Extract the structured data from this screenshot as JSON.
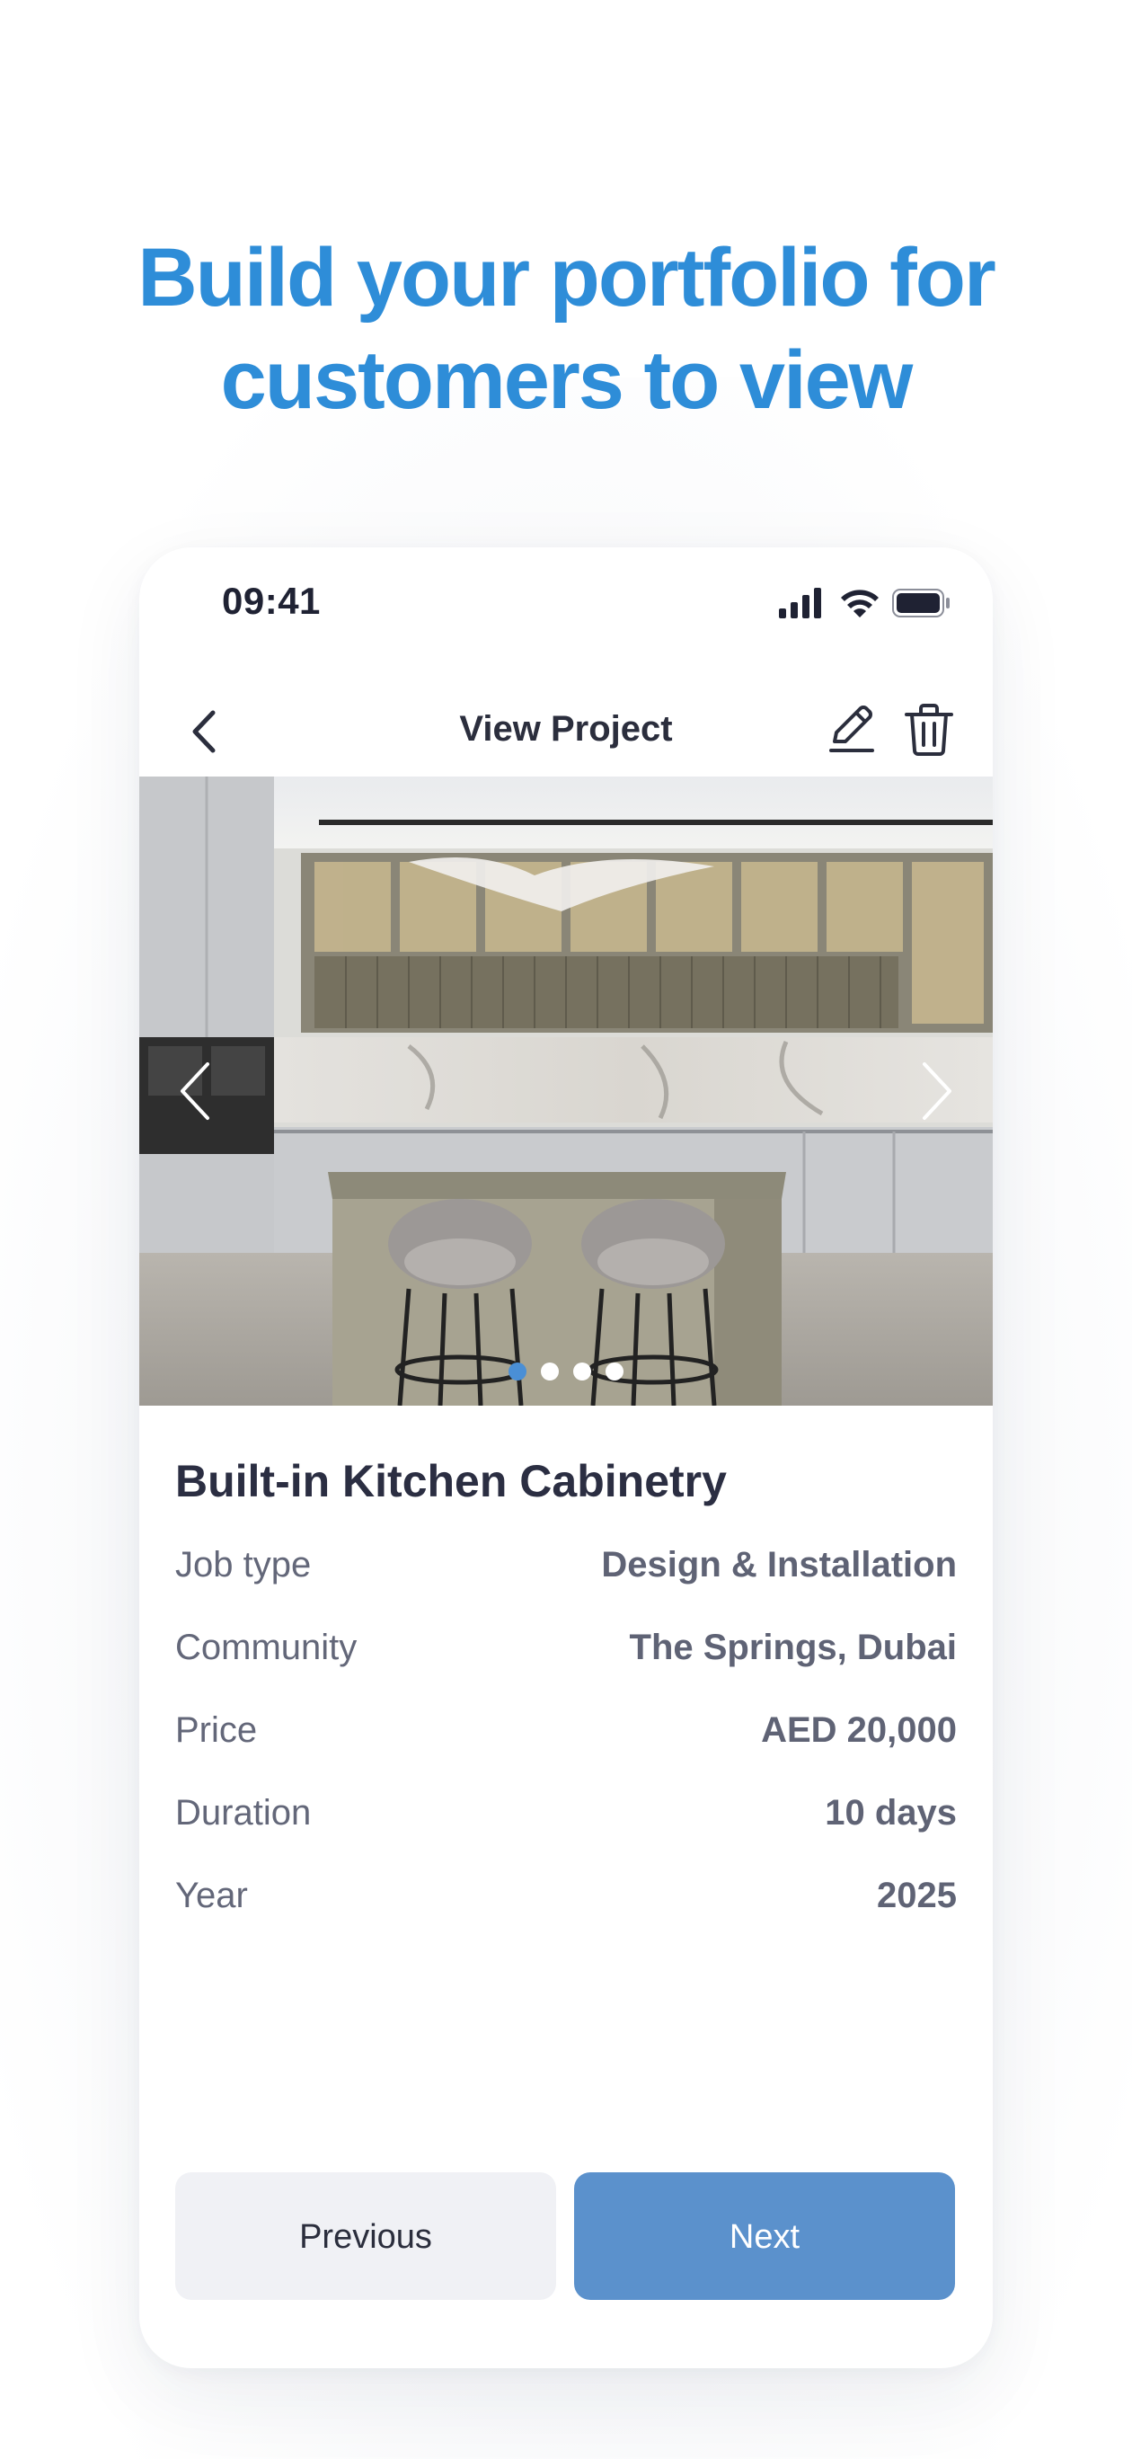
{
  "headline": {
    "line1": "Build your portfolio for",
    "line2": "customers to view"
  },
  "status_bar": {
    "time": "09:41",
    "icons": [
      "signal-icon",
      "wifi-icon",
      "battery-icon"
    ]
  },
  "navbar": {
    "title": "View Project",
    "icons": [
      "back-chevron-icon",
      "edit-pencil-icon",
      "trash-icon"
    ]
  },
  "carousel": {
    "image_subject": "modern kitchen with island and two bar stools",
    "slide_count": 4,
    "active_index": 0
  },
  "project": {
    "title": "Built-in Kitchen Cabinetry",
    "details": [
      {
        "label": "Job type",
        "value": "Design & Installation"
      },
      {
        "label": "Community",
        "value": "The Springs, Dubai"
      },
      {
        "label": "Price",
        "value": "AED 20,000"
      },
      {
        "label": "Duration",
        "value": "10 days"
      },
      {
        "label": "Year",
        "value": "2025"
      }
    ]
  },
  "actions": {
    "previous": "Previous",
    "next": "Next"
  },
  "colors": {
    "headline": "#2e8dd8",
    "primary_button": "#5b91cc",
    "secondary_button": "#f0f1f5",
    "active_dot": "#4a8fd6"
  }
}
